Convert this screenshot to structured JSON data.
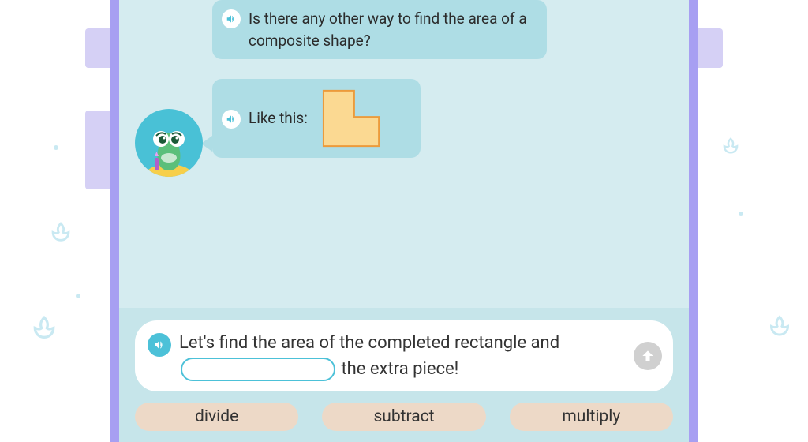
{
  "chat": {
    "msg1": "Is there any other way to find the area of a composite shape?",
    "msg2": "Like this:"
  },
  "prompt": {
    "part1": "Let's find the area of the completed rectangle and ",
    "part2": " the extra piece!"
  },
  "options": {
    "a": "divide",
    "b": "subtract",
    "c": "multiply"
  }
}
